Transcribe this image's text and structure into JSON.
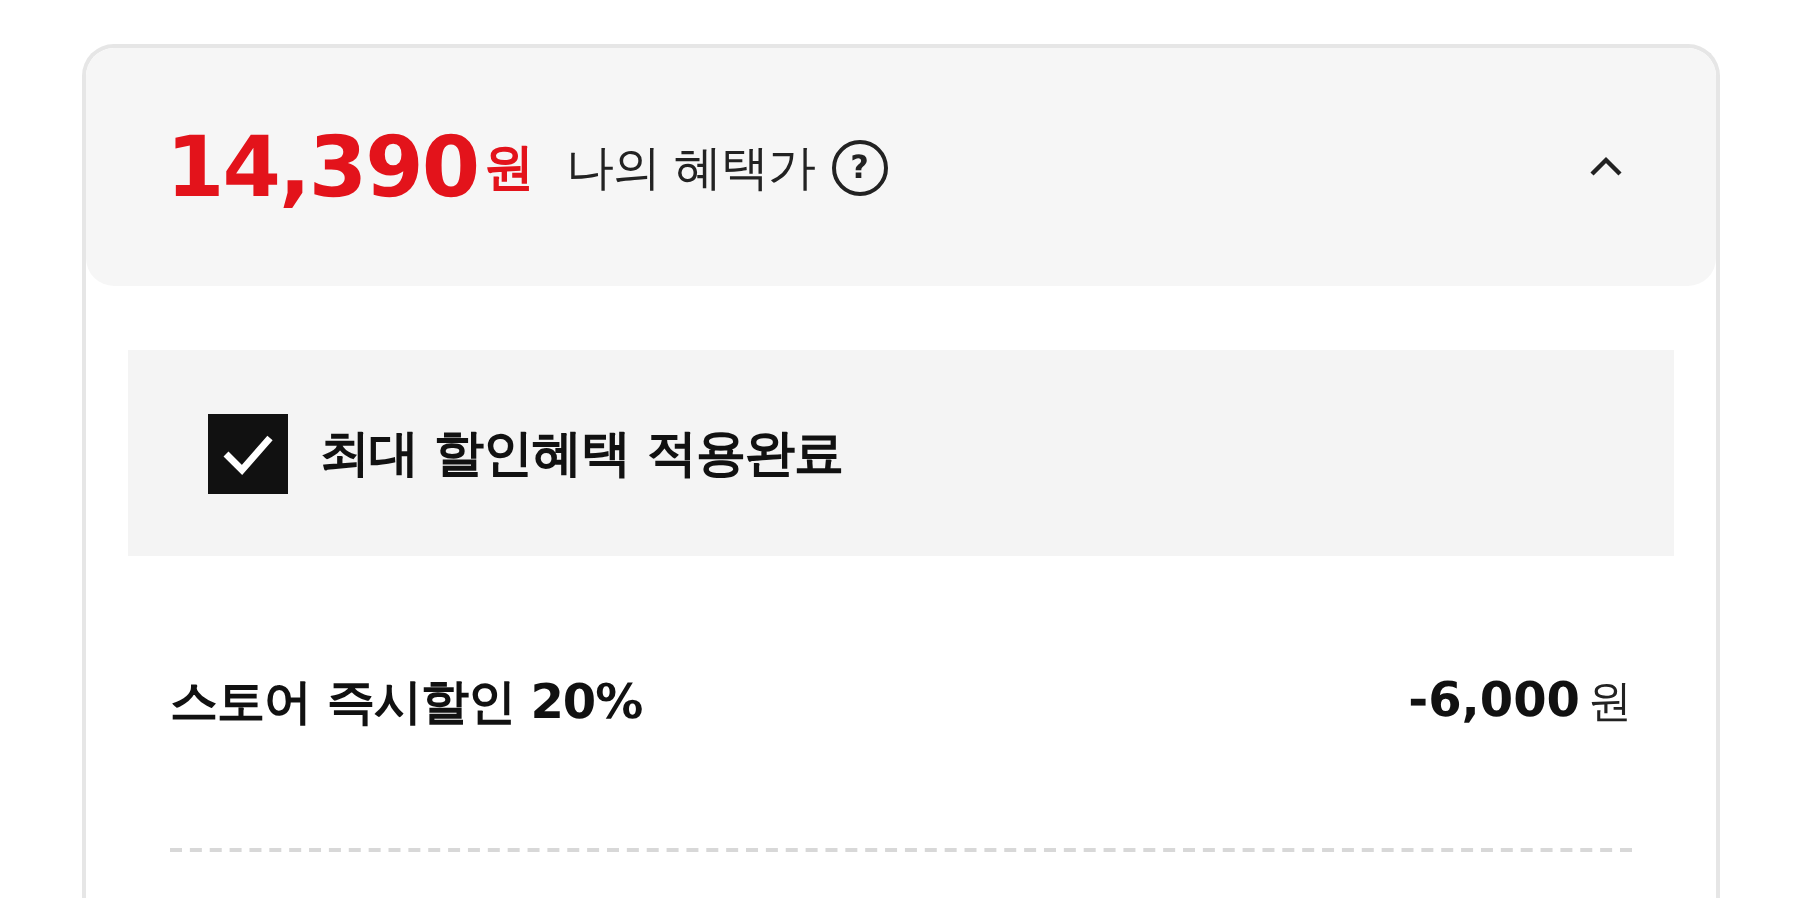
{
  "summary": {
    "price": "14,390",
    "currency": "원",
    "label": "나의 혜택가",
    "help": "?",
    "expanded": true
  },
  "max_discount": {
    "label": "최대 할인혜택 적용완료",
    "checked": true
  },
  "discounts": [
    {
      "label": "스토어 즉시할인 20%",
      "amount": "-6,000",
      "currency": "원"
    }
  ]
}
